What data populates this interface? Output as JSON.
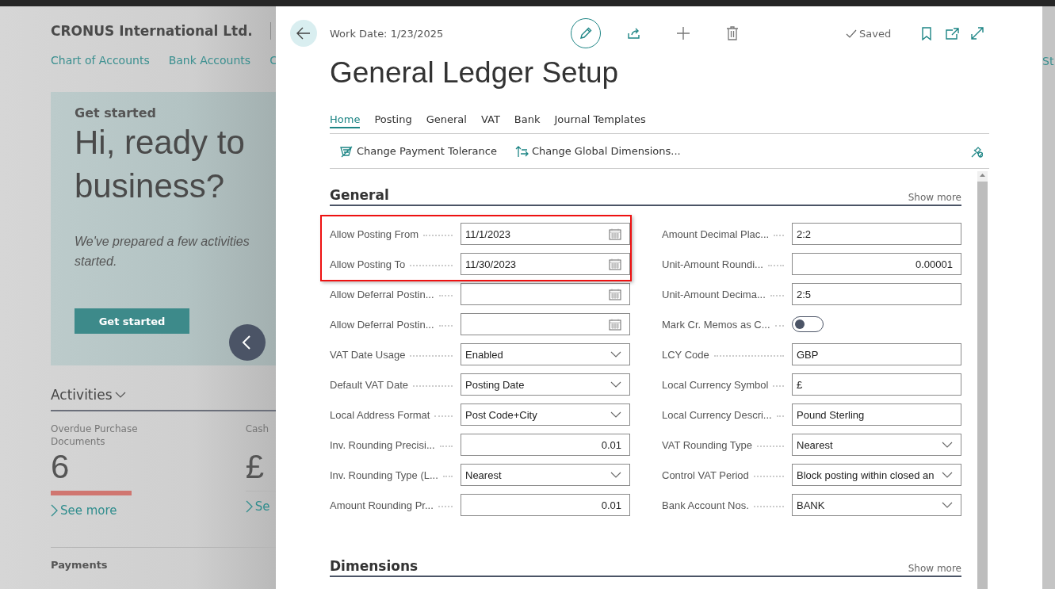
{
  "background_page": {
    "company": "CRONUS International Ltd.",
    "nav_links": [
      "Chart of Accounts",
      "Bank Accounts",
      "C"
    ],
    "banner": {
      "eyebrow": "Get started",
      "headline_lines": [
        "Hi, ready to",
        "business?"
      ],
      "text_lines": [
        "We've prepared a few activities",
        "started."
      ],
      "button": "Get started"
    },
    "activities": {
      "title": "Activities",
      "tiles": [
        {
          "label": "Overdue Purchase Documents",
          "value": "6",
          "link": "See more",
          "color": "#d07670"
        },
        {
          "label": "Cash",
          "value": "£",
          "link": "Se",
          "color": "#b5b5b5"
        }
      ]
    },
    "next_section": "Payments",
    "right_edge_link": "St"
  },
  "dialog": {
    "work_date": "Work Date: 1/23/2025",
    "status": "Saved",
    "title": "General Ledger Setup",
    "tabs": [
      {
        "label": "Home",
        "selected": true
      },
      {
        "label": "Posting",
        "selected": false
      },
      {
        "label": "General",
        "selected": false
      },
      {
        "label": "VAT",
        "selected": false
      },
      {
        "label": "Bank",
        "selected": false
      },
      {
        "label": "Journal Templates",
        "selected": false
      }
    ],
    "actions": [
      {
        "label": "Change Payment Tolerance",
        "kind": "tolerance"
      },
      {
        "label": "Change Global Dimensions...",
        "kind": "dimensions"
      }
    ],
    "sections": [
      {
        "title": "General",
        "show_more": "Show more",
        "left_fields": [
          {
            "label": "Allow Posting From",
            "kind": "date",
            "value": "11/1/2023"
          },
          {
            "label": "Allow Posting To",
            "kind": "date",
            "value": "11/30/2023"
          },
          {
            "label": "Allow Deferral Postin...",
            "kind": "date"
          },
          {
            "label": "Allow Deferral Postin...",
            "kind": "date"
          },
          {
            "label": "VAT Date Usage",
            "kind": "dropdown",
            "value": "Enabled"
          },
          {
            "label": "Default VAT Date",
            "kind": "dropdown",
            "value": "Posting Date"
          },
          {
            "label": "Local Address Format",
            "kind": "dropdown",
            "value": "Post Code+City"
          },
          {
            "label": "Inv. Rounding Precisi...",
            "kind": "number",
            "value": "0.01"
          },
          {
            "label": "Inv. Rounding Type (L...",
            "kind": "dropdown",
            "value": "Nearest"
          },
          {
            "label": "Amount Rounding Pr...",
            "kind": "number",
            "value": "0.01"
          }
        ],
        "right_fields": [
          {
            "label": "Amount Decimal Plac...",
            "kind": "text",
            "value": "2:2"
          },
          {
            "label": "Unit-Amount Roundi...",
            "kind": "number",
            "value": "0.00001"
          },
          {
            "label": "Unit-Amount Decima...",
            "kind": "text",
            "value": "2:5"
          },
          {
            "label": "Mark Cr. Memos as C...",
            "kind": "toggle",
            "on": false
          },
          {
            "label": "LCY Code",
            "kind": "text",
            "value": "GBP"
          },
          {
            "label": "Local Currency Symbol",
            "kind": "text",
            "value": "£"
          },
          {
            "label": "Local Currency Descri...",
            "kind": "text",
            "value": "Pound Sterling"
          },
          {
            "label": "VAT Rounding Type",
            "kind": "dropdown",
            "value": "Nearest"
          },
          {
            "label": "Control VAT Period",
            "kind": "dropdown",
            "value": "Block posting within closed an"
          },
          {
            "label": "Bank Account Nos.",
            "kind": "dropdown",
            "value": "BANK"
          }
        ]
      },
      {
        "title": "Dimensions",
        "show_more": "Show more"
      }
    ]
  }
}
